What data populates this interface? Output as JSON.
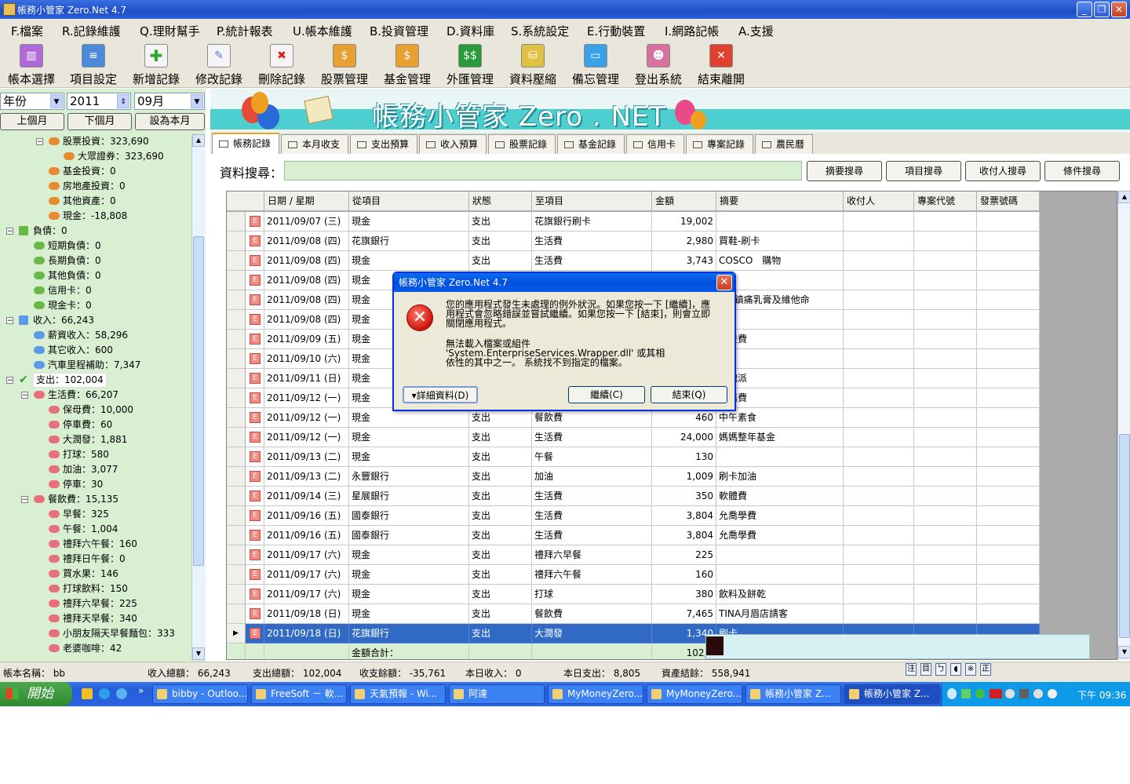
{
  "window": {
    "title": "帳務小管家 Zero.Net 4.7"
  },
  "menu": [
    "F.檔案",
    "R.記錄維護",
    "Q.理財幫手",
    "P.統計報表",
    "U.帳本維護",
    "B.投資管理",
    "D.資料庫",
    "S.系統設定",
    "E.行動裝置",
    "I.網路記帳",
    "A.支援"
  ],
  "toolbar": [
    "帳本選擇",
    "項目設定",
    "新增記錄",
    "修改記錄",
    "刪除記錄",
    "股票管理",
    "基金管理",
    "外匯管理",
    "資料壓縮",
    "備忘管理",
    "登出系統",
    "結束離開"
  ],
  "date_filter": {
    "mode": "年份",
    "year": "2011",
    "month": "09月"
  },
  "nav_buttons": {
    "prev": "上個月",
    "next": "下個月",
    "set": "設為本月"
  },
  "tree": [
    {
      "label": "股票投資：323,690"
    },
    {
      "label": "大眾證券：323,690"
    },
    {
      "label": "基金投資：0"
    },
    {
      "label": "房地產投資：0"
    },
    {
      "label": "其他資產：0"
    },
    {
      "label": "現金：-18,808"
    },
    {
      "label": "負債：0"
    },
    {
      "label": "短期負債：0"
    },
    {
      "label": "長期負債：0"
    },
    {
      "label": "其他負債：0"
    },
    {
      "label": "信用卡：0"
    },
    {
      "label": "現金卡：0"
    },
    {
      "label": "收入：66,243"
    },
    {
      "label": "薪資收入：58,296"
    },
    {
      "label": "其它收入：600"
    },
    {
      "label": "汽車里程補助：7,347"
    },
    {
      "label": "支出：102,004"
    },
    {
      "label": "生活費：66,207"
    },
    {
      "label": "保母費：10,000"
    },
    {
      "label": "停車費：60"
    },
    {
      "label": "大潤發：1,881"
    },
    {
      "label": "打球：580"
    },
    {
      "label": "加油：3,077"
    },
    {
      "label": "停車：30"
    },
    {
      "label": "餐飲費：15,135"
    },
    {
      "label": "早餐：325"
    },
    {
      "label": "午餐：1,004"
    },
    {
      "label": "禮拜六午餐：160"
    },
    {
      "label": "禮拜日午餐：0"
    },
    {
      "label": "買水果：146"
    },
    {
      "label": "打球飲料：150"
    },
    {
      "label": "禮拜六早餐：225"
    },
    {
      "label": "禮拜天早餐：340"
    },
    {
      "label": "小朋友隔天早餐麵包：333"
    },
    {
      "label": "老婆咖啡：42"
    }
  ],
  "banner": {
    "title": "帳務小管家 Zero . NET"
  },
  "tabs": [
    "帳務記錄",
    "本月收支",
    "支出預算",
    "收入預算",
    "股票記錄",
    "基金記錄",
    "信用卡",
    "專案記錄",
    "農民曆"
  ],
  "search": {
    "label": "資料搜尋：",
    "buttons": [
      "摘要搜尋",
      "項目搜尋",
      "收付人搜尋",
      "條件搜尋"
    ]
  },
  "grid": {
    "columns": [
      "日期 / 星期",
      "從項目",
      "狀態",
      "至項目",
      "金額",
      "摘要",
      "收付人",
      "專案代號",
      "發票號碼"
    ],
    "rows": [
      {
        "date": "2011/09/07 (三)",
        "from": "現金",
        "status": "支出",
        "to": "花旗銀行刷卡",
        "amount": "19,002",
        "memo": ""
      },
      {
        "date": "2011/09/08 (四)",
        "from": "花旗銀行",
        "status": "支出",
        "to": "生活費",
        "amount": "2,980",
        "memo": "買鞋-刷卡"
      },
      {
        "date": "2011/09/08 (四)",
        "from": "現金",
        "status": "支出",
        "to": "生活費",
        "amount": "3,743",
        "memo": "COSCO　購物"
      },
      {
        "date": "2011/09/08 (四)",
        "from": "現金",
        "status": "",
        "to": "",
        "amount": "",
        "memo": ""
      },
      {
        "date": "2011/09/08 (四)",
        "from": "現金",
        "status": "",
        "to": "",
        "amount": "",
        "memo": "0買鎮痛乳膏及維他命"
      },
      {
        "date": "2011/09/08 (四)",
        "from": "現金",
        "status": "",
        "to": "",
        "amount": "",
        "memo": ""
      },
      {
        "date": "2011/09/09 (五)",
        "from": "現金",
        "status": "",
        "to": "",
        "amount": "",
        "memo": "畫畫費"
      },
      {
        "date": "2011/09/10 (六)",
        "from": "現金",
        "status": "",
        "to": "",
        "amount": "",
        "memo": ""
      },
      {
        "date": "2011/09/11 (日)",
        "from": "現金",
        "status": "",
        "to": "",
        "amount": "",
        "memo": "玫瑰派"
      },
      {
        "date": "2011/09/12 (一)",
        "from": "現金",
        "status": "",
        "to": "",
        "amount": "",
        "memo": "書籍費"
      },
      {
        "date": "2011/09/12 (一)",
        "from": "現金",
        "status": "支出",
        "to": "餐飲費",
        "amount": "460",
        "memo": "中午素食"
      },
      {
        "date": "2011/09/12 (一)",
        "from": "現金",
        "status": "支出",
        "to": "生活費",
        "amount": "24,000",
        "memo": "媽媽整年基金"
      },
      {
        "date": "2011/09/13 (二)",
        "from": "現金",
        "status": "支出",
        "to": "午餐",
        "amount": "130",
        "memo": ""
      },
      {
        "date": "2011/09/13 (二)",
        "from": "永豐銀行",
        "status": "支出",
        "to": "加油",
        "amount": "1,009",
        "memo": "刷卡加油"
      },
      {
        "date": "2011/09/14 (三)",
        "from": "星展銀行",
        "status": "支出",
        "to": "生活費",
        "amount": "350",
        "memo": "軟體費"
      },
      {
        "date": "2011/09/16 (五)",
        "from": "國泰銀行",
        "status": "支出",
        "to": "生活費",
        "amount": "3,804",
        "memo": "允喬學費"
      },
      {
        "date": "2011/09/16 (五)",
        "from": "國泰銀行",
        "status": "支出",
        "to": "生活費",
        "amount": "3,804",
        "memo": "允喬學費"
      },
      {
        "date": "2011/09/17 (六)",
        "from": "現金",
        "status": "支出",
        "to": "禮拜六早餐",
        "amount": "225",
        "memo": ""
      },
      {
        "date": "2011/09/17 (六)",
        "from": "現金",
        "status": "支出",
        "to": "禮拜六午餐",
        "amount": "160",
        "memo": ""
      },
      {
        "date": "2011/09/17 (六)",
        "from": "現金",
        "status": "支出",
        "to": "打球",
        "amount": "380",
        "memo": "飲料及餅乾"
      },
      {
        "date": "2011/09/18 (日)",
        "from": "現金",
        "status": "支出",
        "to": "餐飲費",
        "amount": "7,465",
        "memo": "TINA月眉店請客"
      },
      {
        "date": "2011/09/18 (日)",
        "from": "花旗銀行",
        "status": "支出",
        "to": "大潤發",
        "amount": "1,340",
        "memo": "刷卡"
      }
    ],
    "total_label": "金額合計：",
    "total_value": "102,0"
  },
  "status": {
    "book_label": "帳本名稱： bb",
    "income_total": "收入總額： 66,243",
    "expense_total": "支出總額： 102,004",
    "balance": "收支餘額： -35,761",
    "today_income": "本日收入： 0",
    "today_expense": "本日支出： 8,805",
    "assets": "資產結餘： 558,941",
    "ime": [
      "注",
      "目",
      "ㄅ",
      "◖",
      "※",
      "正"
    ]
  },
  "taskbar": {
    "start": "開始",
    "tasks": [
      "bibby - Outloo...",
      "FreeSoft － 軟...",
      "天氣預報 - Wi...",
      "阿達",
      "MyMoneyZero...",
      "MyMoneyZero...",
      "帳務小管家 Z...",
      "帳務小管家 Z..."
    ],
    "clock": "下午 09:36"
  },
  "dialog": {
    "title": "帳務小管家 Zero.Net 4.7",
    "message1_lines": [
      "您的應用程式發生未處理的例外狀況。如果您按一下 [繼續]，應",
      "用程式會忽略錯誤並嘗試繼續。如果您按一下 [結束]，則會立即",
      "關閉應用程式。"
    ],
    "message2_lines": [
      "無法載入檔案或組件 'System.EnterpriseServices.Wrapper.dll' 或其相",
      "依性的其中之一。 系統找不到指定的檔案。"
    ],
    "details_button": "▾詳細資料(D)",
    "continue_button": "繼續(C)",
    "quit_button": "結束(Q)"
  }
}
